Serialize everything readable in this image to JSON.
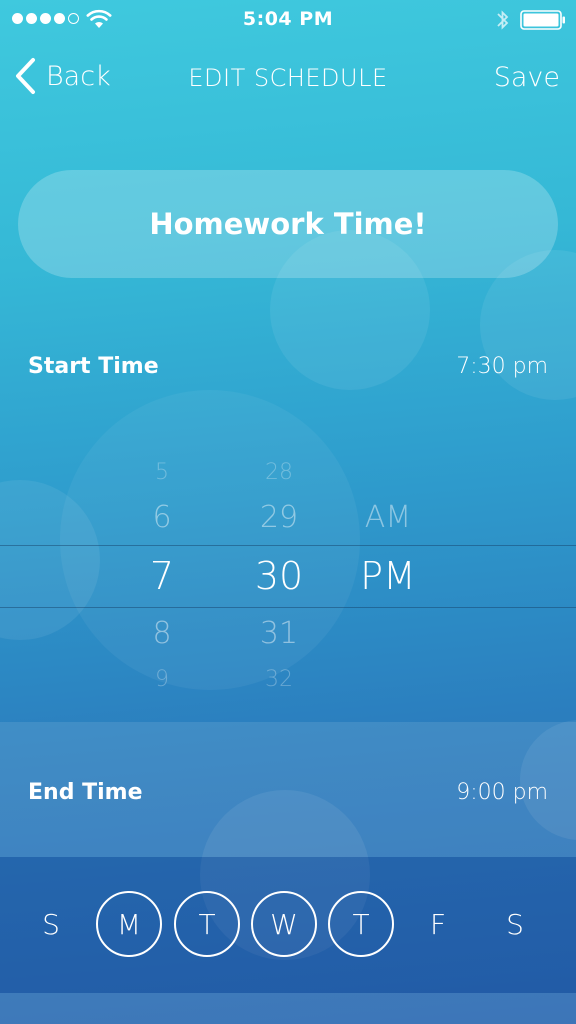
{
  "status_bar": {
    "time": "5:04 PM",
    "signal_bars_filled": 4,
    "signal_bars_total": 5,
    "icons": [
      "wifi-icon",
      "bluetooth-icon",
      "battery-icon"
    ]
  },
  "nav": {
    "back_label": "Back",
    "title": "EDIT SCHEDULE",
    "save_label": "Save"
  },
  "schedule": {
    "name": "Homework Time!"
  },
  "start_time": {
    "label": "Start Time",
    "value": "7:30 pm"
  },
  "picker": {
    "hours": [
      "5",
      "6",
      "7",
      "8",
      "9"
    ],
    "minutes": [
      "28",
      "29",
      "30",
      "31",
      "32"
    ],
    "periods": [
      "AM",
      "PM"
    ],
    "selected": {
      "hour": "7",
      "minute": "30",
      "period": "PM"
    }
  },
  "end_time": {
    "label": "End Time",
    "value": "9:00 pm"
  },
  "days": [
    {
      "label": "S",
      "selected": false
    },
    {
      "label": "M",
      "selected": true
    },
    {
      "label": "T",
      "selected": true
    },
    {
      "label": "W",
      "selected": true
    },
    {
      "label": "T",
      "selected": true
    },
    {
      "label": "F",
      "selected": false
    },
    {
      "label": "S",
      "selected": false
    }
  ],
  "colors": {
    "gradient_top": "#3fc9de",
    "gradient_bottom": "#2866b0",
    "text": "#ffffff"
  }
}
